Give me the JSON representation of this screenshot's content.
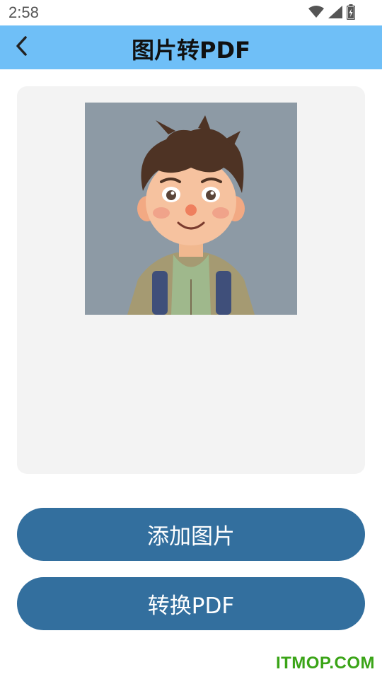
{
  "status_bar": {
    "time": "2:58",
    "icons": [
      "wifi-icon",
      "cell-signal-icon",
      "battery-charging-icon"
    ]
  },
  "app_bar": {
    "title": "图片转PDF",
    "back_icon": "chevron-left-icon",
    "background_color": "#6fbff7"
  },
  "preview": {
    "image_description_icon": "cartoon-boy-image",
    "panel_color": "#f3f3f3"
  },
  "actions": {
    "add_images_label": "添加图片",
    "convert_label": "转换PDF",
    "button_color": "#336f9e"
  },
  "watermark": {
    "text": "ITMOP.COM",
    "color": "#3aa417"
  }
}
